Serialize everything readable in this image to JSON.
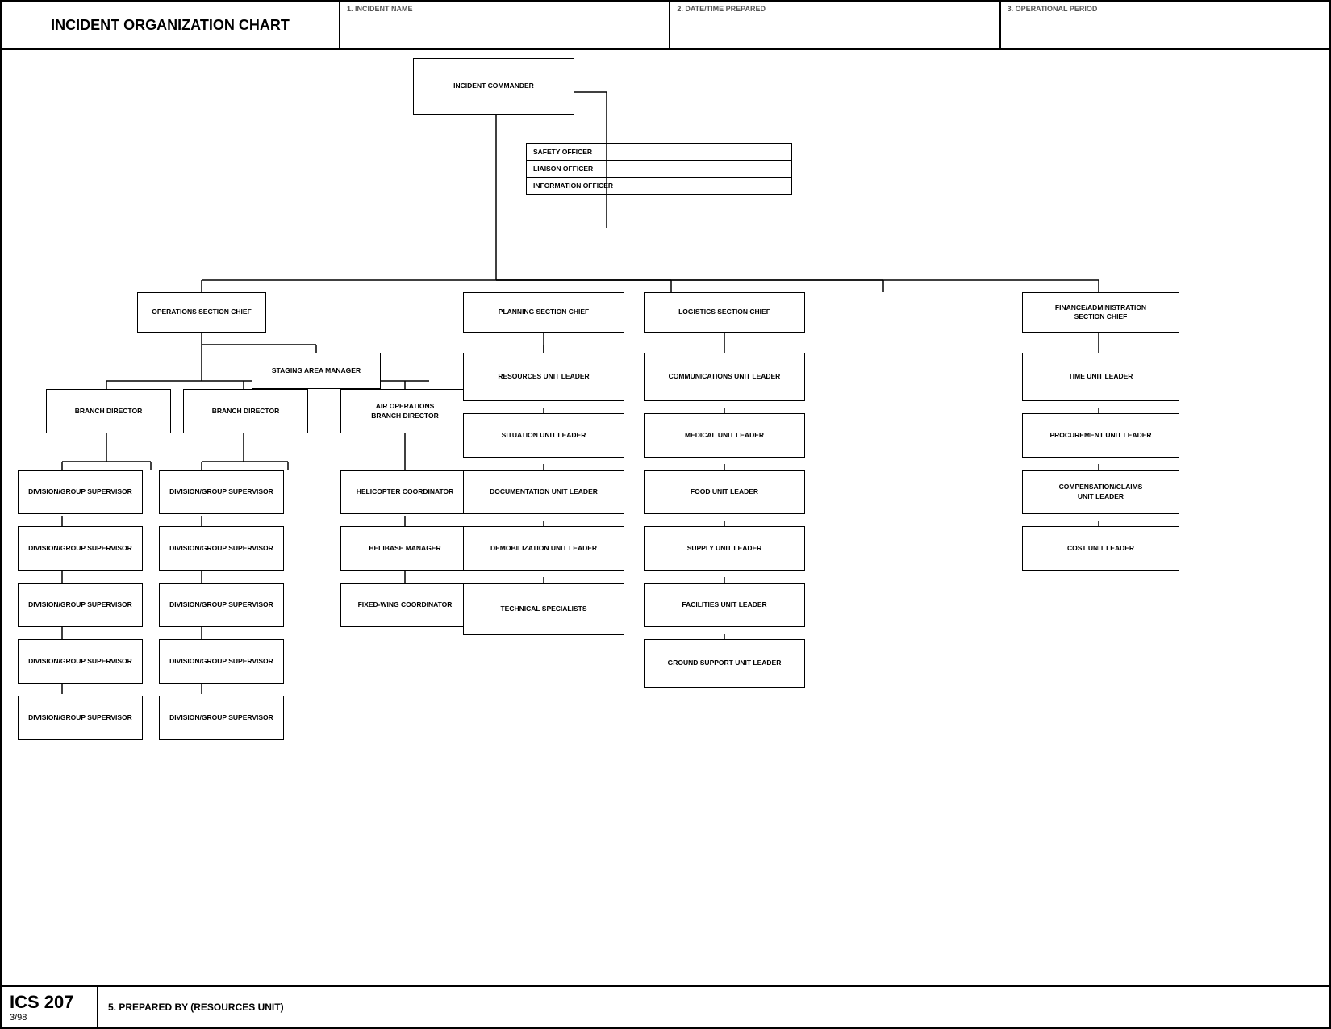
{
  "header": {
    "title": "INCIDENT ORGANIZATION CHART",
    "field1_label": "1. INCIDENT NAME",
    "field2_label": "2. DATE/TIME PREPARED",
    "field3_label": "3. OPERATIONAL PERIOD"
  },
  "boxes": {
    "incident_commander": "INCIDENT COMMANDER",
    "safety_officer": "SAFETY OFFICER",
    "liaison_officer": "LIAISON OFFICER",
    "information_officer": "INFORMATION OFFICER",
    "operations_chief": "OPERATIONS SECTION CHIEF",
    "planning_chief": "PLANNING SECTION CHIEF",
    "logistics_chief": "LOGISTICS SECTION CHIEF",
    "finance_chief": "FINANCE/ADMINISTRATION\nSECTION CHIEF",
    "staging_area": "STAGING AREA MANAGER",
    "branch_dir1": "BRANCH DIRECTOR",
    "branch_dir2": "BRANCH DIRECTOR",
    "air_ops": "AIR OPERATIONS\nBRANCH DIRECTOR",
    "div_grp1_1": "DIVISION/GROUP SUPERVISOR",
    "div_grp1_2": "DIVISION/GROUP SUPERVISOR",
    "div_grp1_3": "DIVISION/GROUP SUPERVISOR",
    "div_grp1_4": "DIVISION/GROUP SUPERVISOR",
    "div_grp1_5": "DIVISION/GROUP SUPERVISOR",
    "div_grp2_1": "DIVISION/GROUP SUPERVISOR",
    "div_grp2_2": "DIVISION/GROUP SUPERVISOR",
    "div_grp2_3": "DIVISION/GROUP SUPERVISOR",
    "div_grp2_4": "DIVISION/GROUP SUPERVISOR",
    "div_grp2_5": "DIVISION/GROUP SUPERVISOR",
    "heli_coord": "HELICOPTER COORDINATOR",
    "helibase_mgr": "HELIBASE MANAGER",
    "fixed_wing": "FIXED-WING COORDINATOR",
    "resources_ul": "RESOURCES UNIT LEADER",
    "situation_ul": "SITUATION UNIT LEADER",
    "documentation_ul": "DOCUMENTATION UNIT LEADER",
    "demob_ul": "DEMOBILIZATION UNIT LEADER",
    "tech_specialists": "TECHNICAL SPECIALISTS",
    "comms_ul": "COMMUNICATIONS UNIT LEADER",
    "medical_ul": "MEDICAL UNIT LEADER",
    "food_ul": "FOOD UNIT LEADER",
    "supply_ul": "SUPPLY UNIT LEADER",
    "facilities_ul": "FACILITIES UNIT LEADER",
    "ground_support_ul": "GROUND SUPPORT UNIT LEADER",
    "time_ul": "TIME UNIT LEADER",
    "procurement_ul": "PROCUREMENT UNIT LEADER",
    "comp_claims_ul": "COMPENSATION/CLAIMS\nUNIT LEADER",
    "cost_ul": "COST UNIT LEADER"
  },
  "footer": {
    "ics_number": "ICS 207",
    "date": "3/98",
    "prepared_label": "5. PREPARED BY (RESOURCES UNIT)"
  }
}
